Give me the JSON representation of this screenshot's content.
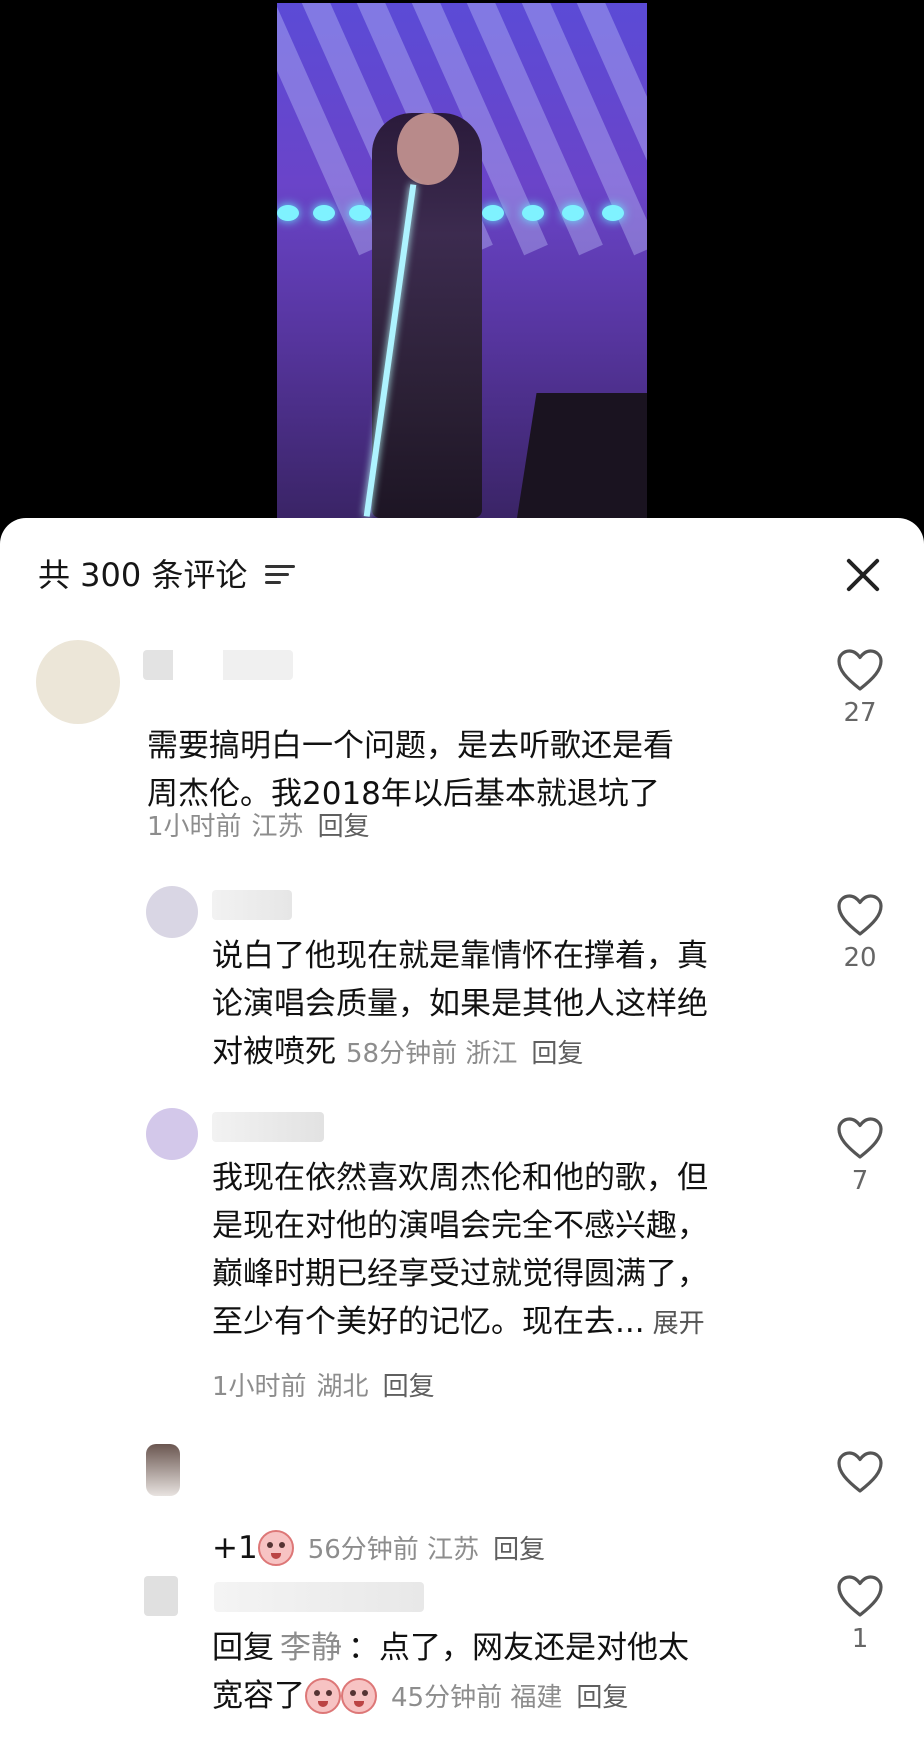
{
  "header": {
    "comment_count": "共 300 条评论"
  },
  "comments": [
    {
      "text_line1": "需要搞明白一个问题，是去听歌还是看",
      "text_line2": "周杰伦。我2018年以后基本就退坑了",
      "time": "1小时前",
      "location": "江苏",
      "reply_label": "回复",
      "likes": "27"
    },
    {
      "text_line1": "说白了他现在就是靠情怀在撑着，真",
      "text_line2": "论演唱会质量，如果是其他人这样绝",
      "text_line3": "对被喷死",
      "time": "58分钟前",
      "location": "浙江",
      "reply_label": "回复",
      "likes": "20"
    },
    {
      "text_line1": "我现在依然喜欢周杰伦和他的歌，但",
      "text_line2": "是现在对他的演唱会完全不感兴趣，",
      "text_line3": "巅峰时期已经享受过就觉得圆满了，",
      "text_line4": "至少有个美好的记忆。现在去...",
      "expand_label": "展开",
      "time": "1小时前",
      "location": "湖北",
      "reply_label": "回复",
      "likes": "7"
    },
    {
      "text": "+1",
      "time": "56分钟前",
      "location": "江苏",
      "reply_label": "回复",
      "likes": ""
    },
    {
      "reply_prefix": "回复",
      "reply_to": "李静",
      "text_line1_rest": "：点了，网友还是对他太",
      "text_line2": "宽容了",
      "time": "45分钟前",
      "location": "福建",
      "reply_label": "回复",
      "likes": "1"
    }
  ],
  "colors": {
    "accent_text": "#111111",
    "meta_text": "#8d8d8d",
    "background": "#ffffff"
  },
  "icons": [
    "filter-icon",
    "close-icon",
    "heart-icon",
    "emoji-icon"
  ]
}
